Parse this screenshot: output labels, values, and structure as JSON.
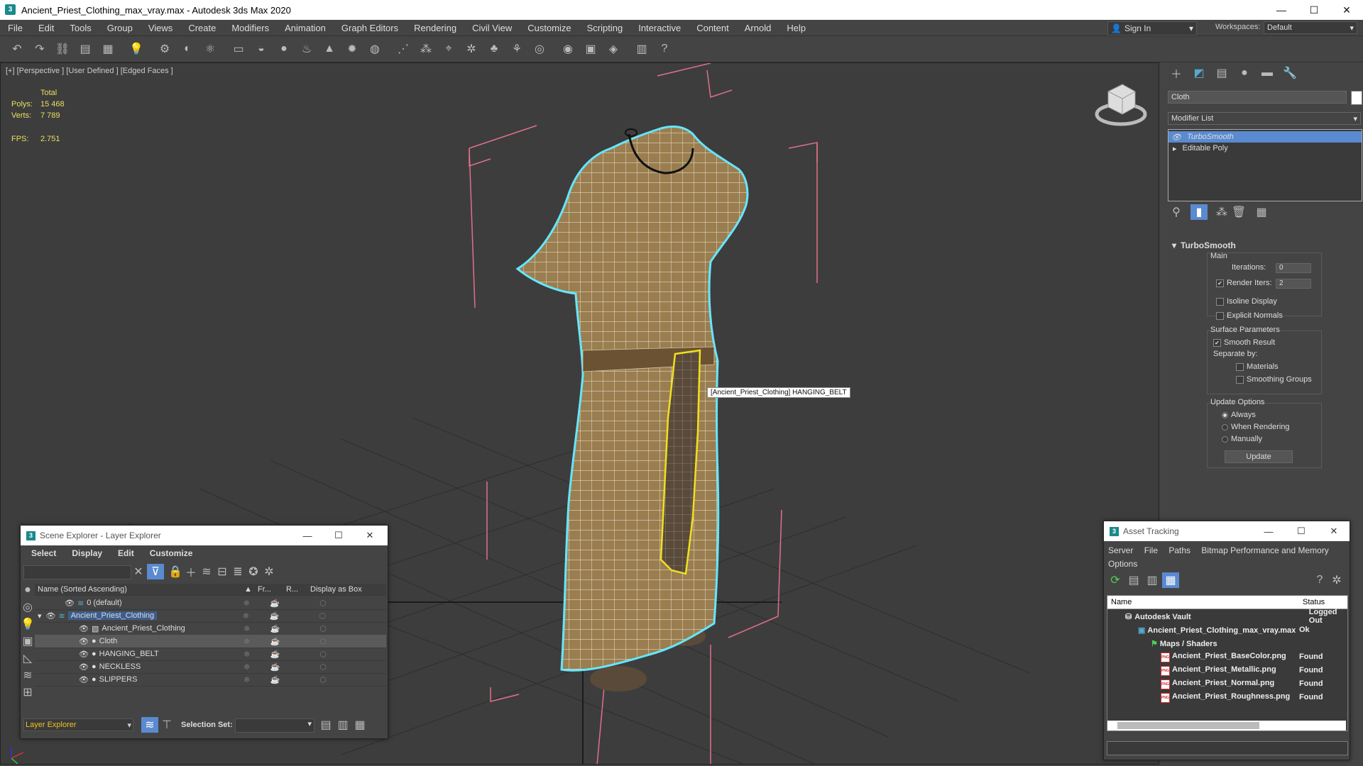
{
  "window": {
    "title": "Ancient_Priest_Clothing_max_vray.max - Autodesk 3ds Max 2020",
    "minimize": "—",
    "maximize": "☐",
    "close": "✕"
  },
  "menu": [
    "File",
    "Edit",
    "Tools",
    "Group",
    "Views",
    "Create",
    "Modifiers",
    "Animation",
    "Graph Editors",
    "Rendering",
    "Civil View",
    "Customize",
    "Scripting",
    "Interactive",
    "Content",
    "Arnold",
    "Help"
  ],
  "signin": {
    "label": "Sign In",
    "arrow": "▾"
  },
  "workspaces": {
    "label": "Workspaces:",
    "value": "Default"
  },
  "viewport": {
    "label": "[+] [Perspective ] [User Defined ] [Edged Faces ]",
    "stats": {
      "total_label": "Total",
      "polys_label": "Polys:",
      "polys": "15 468",
      "verts_label": "Verts:",
      "verts": "7 789",
      "fps_label": "FPS:",
      "fps": "2.751"
    },
    "tooltip": "[Ancient_Priest_Clothing] HANGING_BELT",
    "colors": {
      "selection": "#66e6ff",
      "highlight": "#f0e020",
      "bbox": "#e0708a",
      "cloth": "#9a7e50"
    }
  },
  "command_panel": {
    "object_name": "Cloth",
    "modifier_list": "Modifier List",
    "stack": [
      {
        "label": "TurboSmooth",
        "selected": true
      },
      {
        "label": "Editable Poly",
        "selected": false
      }
    ],
    "turbosmooth": {
      "header": "TurboSmooth",
      "main": "Main",
      "iterations_label": "Iterations:",
      "iterations": "0",
      "render_iters_label": "Render Iters:",
      "render_iters": "2",
      "isoline": "Isoline Display",
      "explicit": "Explicit Normals",
      "surface_params": "Surface Parameters",
      "smooth_result": "Smooth Result",
      "separate_by": "Separate by:",
      "materials": "Materials",
      "smoothing_groups": "Smoothing Groups",
      "update_options": "Update Options",
      "always": "Always",
      "when_rendering": "When Rendering",
      "manually": "Manually",
      "update_button": "Update"
    }
  },
  "scene_explorer": {
    "title": "Scene Explorer - Layer Explorer",
    "menu": [
      "Select",
      "Display",
      "Edit",
      "Customize"
    ],
    "columns": {
      "name": "Name (Sorted Ascending)",
      "sort": "▲",
      "frozen": "Fr...",
      "render": "R...",
      "box": "Display as Box"
    },
    "rows": [
      {
        "label": "0 (default)",
        "indent": 1
      },
      {
        "label": "Ancient_Priest_Clothing",
        "indent": 1
      },
      {
        "label": "Ancient_Priest_Clothing",
        "indent": 2
      },
      {
        "label": "Cloth",
        "indent": 2
      },
      {
        "label": "HANGING_BELT",
        "indent": 2
      },
      {
        "label": "NECKLESS",
        "indent": 2
      },
      {
        "label": "SLIPPERS",
        "indent": 2
      }
    ],
    "footer_explorer": "Layer Explorer",
    "selection_set_label": "Selection Set:"
  },
  "asset_tracking": {
    "title": "Asset Tracking",
    "menu": [
      "Server",
      "File",
      "Paths",
      "Bitmap Performance and Memory"
    ],
    "menu2": "Options",
    "columns": {
      "name": "Name",
      "status": "Status"
    },
    "rows": [
      {
        "name": "Autodesk Vault",
        "status": "Logged Out"
      },
      {
        "name": "Ancient_Priest_Clothing_max_vray.max",
        "status": "Ok"
      },
      {
        "name": "Maps / Shaders",
        "status": ""
      },
      {
        "name": "Ancient_Priest_BaseColor.png",
        "status": "Found"
      },
      {
        "name": "Ancient_Priest_Metallic.png",
        "status": "Found"
      },
      {
        "name": "Ancient_Priest_Normal.png",
        "status": "Found"
      },
      {
        "name": "Ancient_Priest_Roughness.png",
        "status": "Found"
      }
    ]
  }
}
